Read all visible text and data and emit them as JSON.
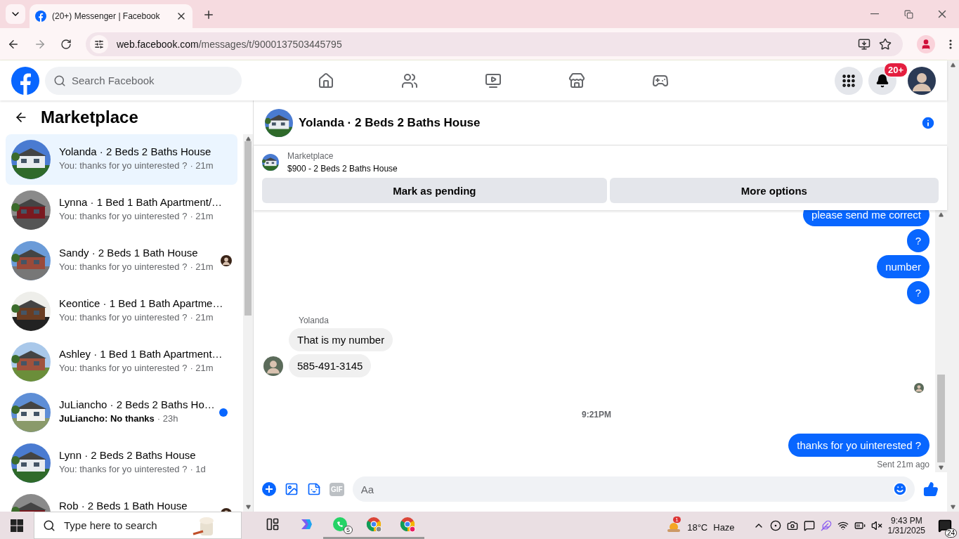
{
  "browser": {
    "tab": {
      "title": "(20+) Messenger | Facebook"
    },
    "url": {
      "domain": "web.facebook.com",
      "path": "/messages/t/9000137503445795"
    }
  },
  "topbar": {
    "search": {
      "placeholder": "Search Facebook"
    },
    "notifications": {
      "badge": "20+"
    }
  },
  "sidebar": {
    "title": "Marketplace",
    "conversations": [
      {
        "title": "Yolanda · 2 Beds 2 Baths House",
        "preview": "You: thanks for yo uinterested ?",
        "time": "· 21m",
        "selected": true,
        "unread": false,
        "seen": false
      },
      {
        "title": "Lynna · 1 Bed 1 Bath Apartment/…",
        "preview": "You: thanks for yo uinterested ?",
        "time": "· 21m",
        "selected": false,
        "unread": false,
        "seen": false
      },
      {
        "title": "Sandy · 2 Beds 1 Bath House",
        "preview": "You: thanks for yo uinterested ?",
        "time": "· 21m",
        "selected": false,
        "unread": false,
        "seen": true
      },
      {
        "title": "Keontice · 1 Bed 1 Bath Apartme…",
        "preview": "You: thanks for yo uinterested ?",
        "time": "· 21m",
        "selected": false,
        "unread": false,
        "seen": false
      },
      {
        "title": "Ashley · 1 Bed 1 Bath Apartment…",
        "preview": "You: thanks for yo uinterested ?",
        "time": "· 21m",
        "selected": false,
        "unread": false,
        "seen": false
      },
      {
        "title": "JuLiancho · 2 Beds 2 Baths Ho…",
        "preview": "JuLiancho: No thanks",
        "time": "· 23h",
        "selected": false,
        "unread": true,
        "seen": false
      },
      {
        "title": "Lynn · 2 Beds 2 Baths House",
        "preview": "You: thanks for yo uinterested ?",
        "time": "· 1d",
        "selected": false,
        "unread": false,
        "seen": false
      },
      {
        "title": "Rob · 2 Beds 1 Bath House",
        "selected": false,
        "unread": false,
        "seen": true
      }
    ]
  },
  "chat": {
    "title": "Yolanda · 2 Beds 2 Baths House",
    "listing": {
      "label": "Marketplace",
      "title": "$900 - 2 Beds 2 Baths House"
    },
    "buttons": [
      "Mark as pending",
      "More options"
    ],
    "messages": [
      {
        "kind": "outgoing",
        "text": "please send me correct"
      },
      {
        "kind": "outgoing",
        "text": "?"
      },
      {
        "kind": "outgoing",
        "text": "number"
      },
      {
        "kind": "outgoing",
        "text": "?"
      },
      {
        "kind": "sender",
        "text": "Yolanda"
      },
      {
        "kind": "incoming",
        "text": "That is my number",
        "avatar": false
      },
      {
        "kind": "incoming",
        "text": "585-491-3145",
        "avatar": true
      },
      {
        "kind": "seen"
      },
      {
        "kind": "timestamp",
        "text": "9:21PM"
      },
      {
        "kind": "outgoing",
        "text": "thanks for yo uinterested ?"
      },
      {
        "kind": "status",
        "text": "Sent 21m ago"
      }
    ],
    "composer": {
      "gif": "GIF",
      "placeholder": "Aa"
    }
  },
  "taskbar": {
    "search": {
      "placeholder": "Type here to search"
    },
    "apps": [
      {
        "kind": "task-view",
        "running": false
      },
      {
        "kind": "copilot",
        "running": false
      },
      {
        "kind": "whatsapp",
        "running": true,
        "badge": "5"
      },
      {
        "kind": "chrome",
        "running": true
      },
      {
        "kind": "chrome-profile",
        "running": true
      }
    ],
    "weather": {
      "badge": "1",
      "temperature": "18°C",
      "condition": "Haze"
    },
    "clock": {
      "time": "9:43 PM",
      "date": "1/31/2025"
    },
    "notifications": {
      "badge": "24"
    }
  }
}
